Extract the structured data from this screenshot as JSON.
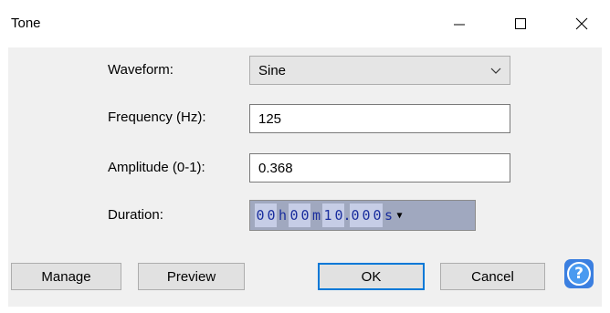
{
  "window": {
    "title": "Tone",
    "controls": [
      "minimize-icon",
      "maximize-icon",
      "close-icon"
    ]
  },
  "form": {
    "waveform_label": "Waveform:",
    "waveform_value": "Sine",
    "frequency_label": "Frequency (Hz):",
    "frequency_value": "125",
    "amplitude_label": "Amplitude (0-1):",
    "amplitude_value": "0.368",
    "duration_label": "Duration:",
    "duration": {
      "hours": [
        "0",
        "0"
      ],
      "hours_unit": "h",
      "minutes": [
        "0",
        "0"
      ],
      "minutes_unit": "m",
      "seconds": [
        "1",
        "0"
      ],
      "decimal": ".",
      "fraction": [
        "0",
        "0",
        "0"
      ],
      "seconds_unit": "s",
      "menu_caret": "▼"
    }
  },
  "buttons": {
    "manage": "Manage",
    "preview": "Preview",
    "ok": "OK",
    "cancel": "Cancel",
    "help": "?"
  },
  "colors": {
    "dialog_bg": "#f0f0f0",
    "default_button_border": "#0078d7",
    "time_digits": "#1b2f9e",
    "help_blue": "#3b7fe0"
  }
}
